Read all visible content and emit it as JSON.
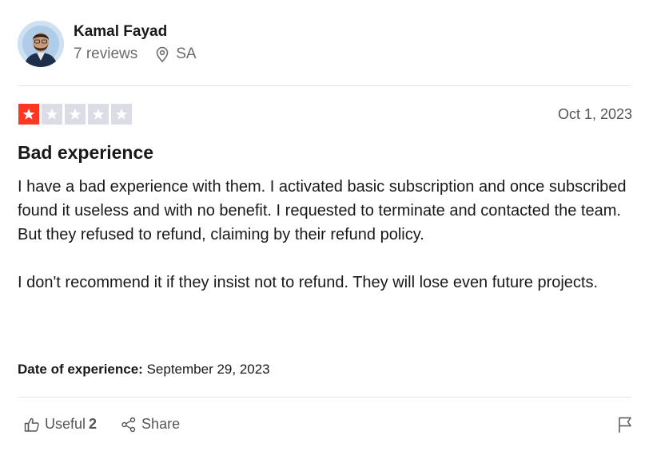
{
  "reviewer": {
    "name": "Kamal Fayad",
    "reviews_count": "7 reviews",
    "location": "SA",
    "avatar_icon": "avatar-photo",
    "location_icon": "location-pin-icon"
  },
  "review": {
    "rating": 1,
    "max_rating": 5,
    "star_filled_color": "#ff3722",
    "star_empty_color": "#dcdce6",
    "date": "Oct 1, 2023",
    "title": "Bad experience",
    "paragraphs": [
      "I have a bad experience with them. I activated basic subscription and once subscribed found it useless and with no benefit. I requested to terminate and contacted the team. But they refused to refund, claiming by their refund policy.",
      "I don't recommend it if they insist not to refund. They will lose even future projects."
    ],
    "date_of_experience_label": "Date of experience:",
    "date_of_experience_value": "September 29, 2023"
  },
  "actions": {
    "useful_label": "Useful",
    "useful_count": "2",
    "share_label": "Share",
    "useful_icon": "thumbs-up-icon",
    "share_icon": "share-icon",
    "report_icon": "flag-icon"
  }
}
